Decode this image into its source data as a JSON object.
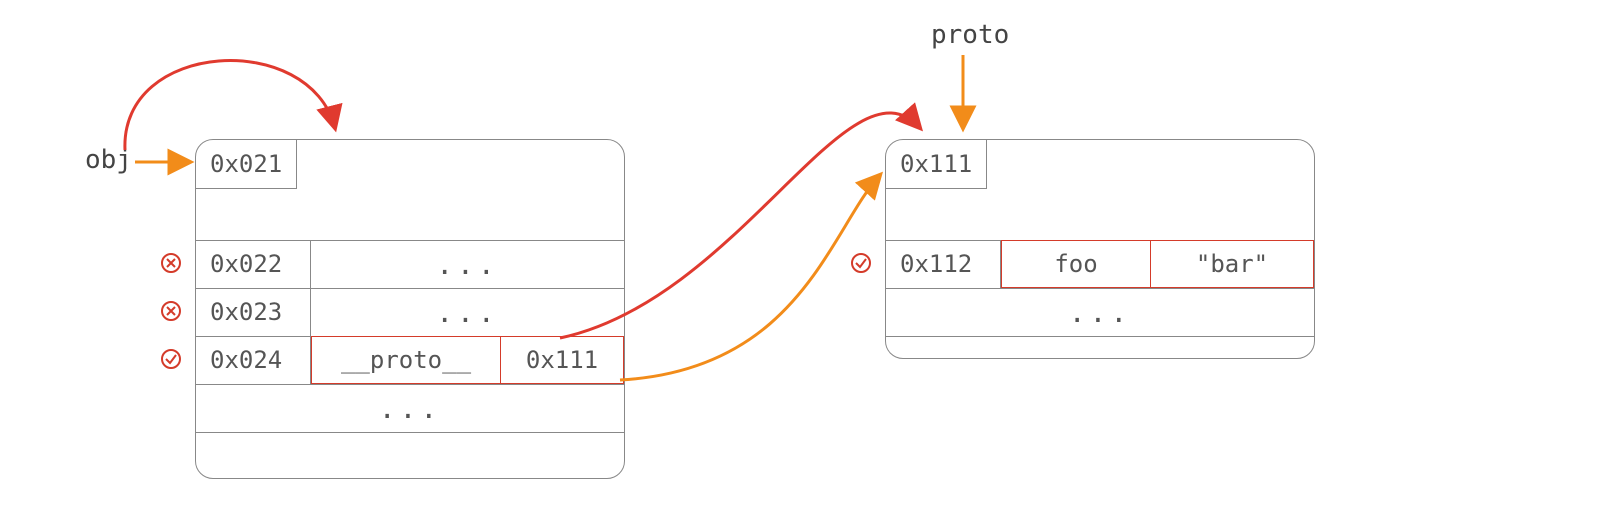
{
  "labels": {
    "obj": "obj",
    "proto": "proto"
  },
  "objBox": {
    "header": "0x021",
    "rows": [
      {
        "addr": "0x022",
        "key": "",
        "val": "...",
        "match": false
      },
      {
        "addr": "0x023",
        "key": "",
        "val": "...",
        "match": false
      },
      {
        "addr": "0x024",
        "key": "__proto__",
        "val": "0x111",
        "match": true
      }
    ],
    "ellipsis": "..."
  },
  "protoBox": {
    "header": "0x111",
    "rows": [
      {
        "addr": "0x112",
        "key": "foo",
        "val": "\"bar\"",
        "match": true
      }
    ],
    "ellipsis": "..."
  }
}
